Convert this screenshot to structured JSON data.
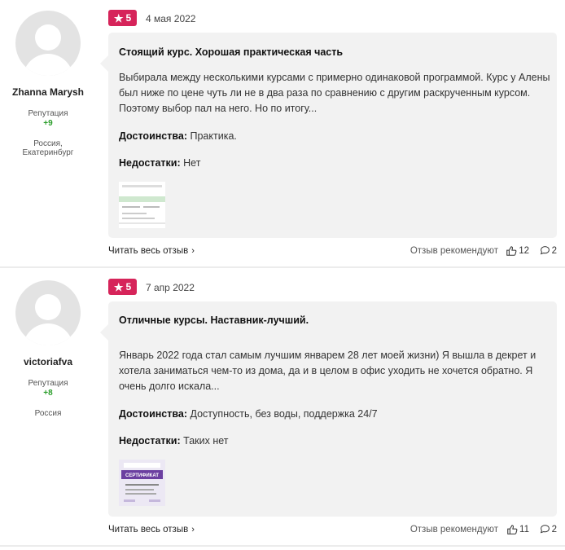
{
  "reviews": [
    {
      "author": "Zhanna Marysh",
      "reputation_label": "Репутация",
      "reputation_value": "+9",
      "location": "Россия, Екатеринбург",
      "rating": "5",
      "date": "4 мая 2022",
      "title": "Стоящий курс. Хорошая практическая часть",
      "text": "Выбирала между несколькими курсами с примерно одинаковой программой. Курс у Алены был ниже по цене чуть ли не в два раза по сравнению с другим раскрученным курсом. Поэтому выбор пал на него. Но по итогу...",
      "pros_label": "Достоинства:",
      "pros": "Практика.",
      "cons_label": "Недостатки:",
      "cons": "Нет",
      "read_more": "Читать весь отзыв",
      "recommend": "Отзыв рекомендуют",
      "likes": "12",
      "comments": "2"
    },
    {
      "author": "victoriafva",
      "reputation_label": "Репутация",
      "reputation_value": "+8",
      "location": "Россия",
      "rating": "5",
      "date": "7 апр 2022",
      "title": "Отличные курсы. Наставник-лучший.",
      "text": "Январь 2022 года стал самым лучшим январем 28 лет моей жизни) Я вышла в декрет и хотела заниматься чем-то из дома, да и в целом в офис уходить не хочется обратно. Я очень долго искала...",
      "pros_label": "Достоинства:",
      "pros": "Доступность, без воды, поддержка 24/7",
      "cons_label": "Недостатки:",
      "cons": "Таких нет",
      "read_more": "Читать весь отзыв",
      "recommend": "Отзыв рекомендуют",
      "likes": "11",
      "comments": "2",
      "certificate_label": "СЕРТИФИКАТ"
    }
  ],
  "icons": {
    "star": "star-icon",
    "chevron": "chevron-right-icon",
    "like": "thumbs-up-icon",
    "comment": "comment-icon"
  },
  "colors": {
    "rating_badge": "#d6245a",
    "reputation_positive": "#2a9d2a",
    "bubble_bg": "#f2f2f2",
    "certificate_purple": "#6b3fa0"
  }
}
